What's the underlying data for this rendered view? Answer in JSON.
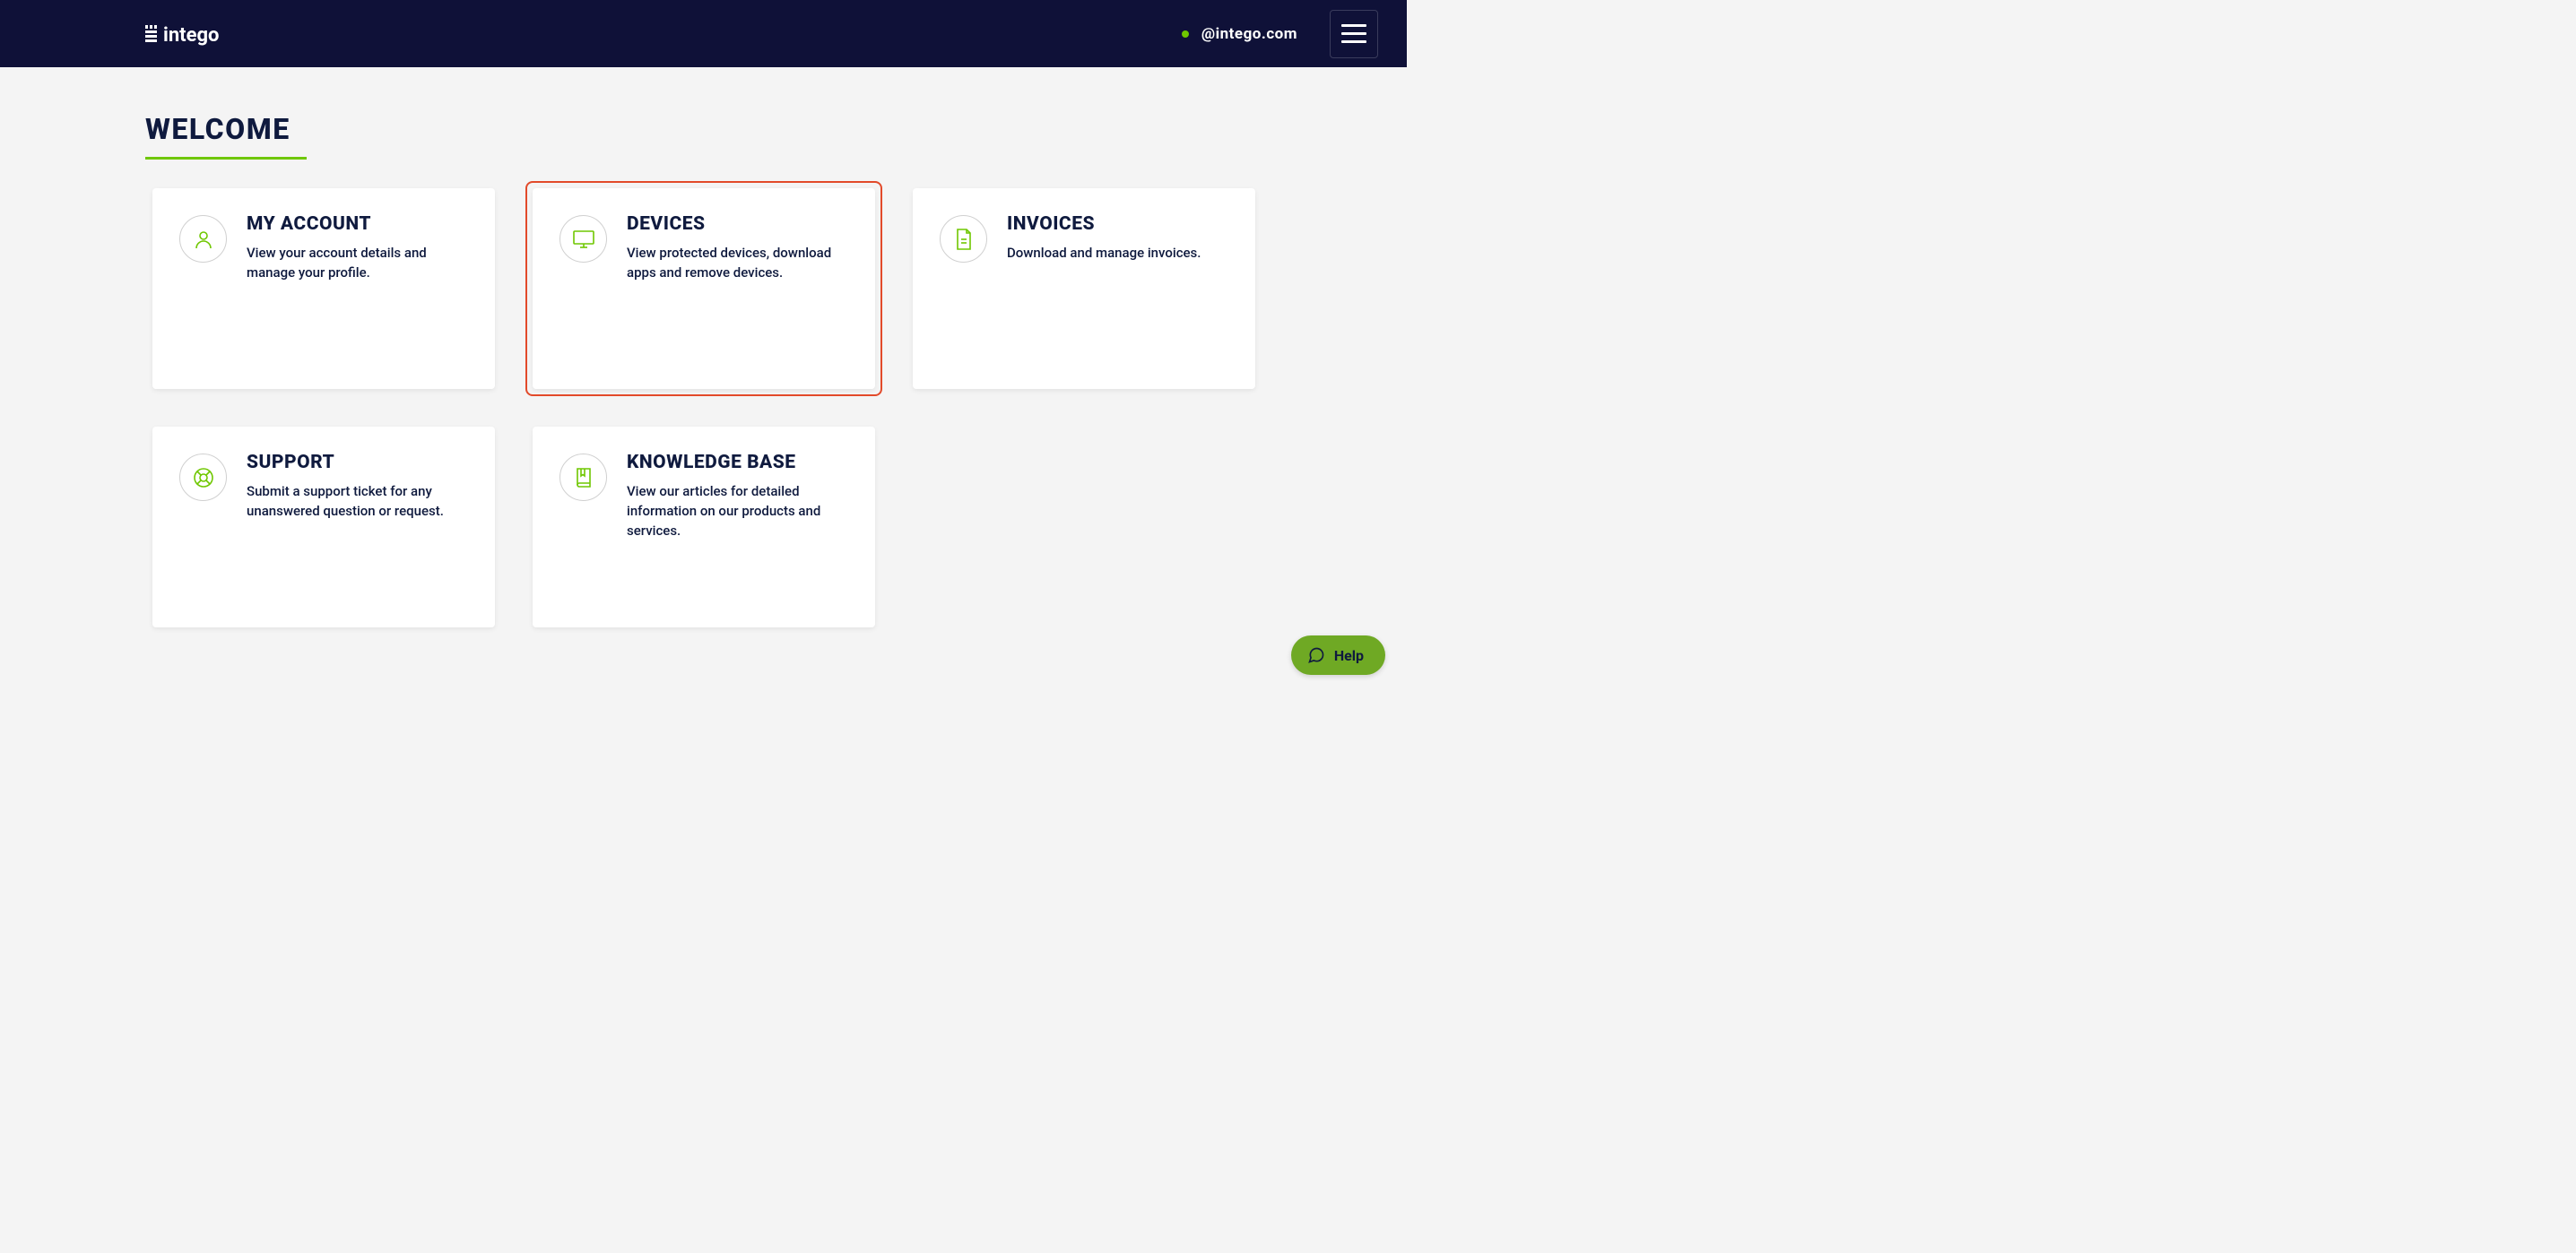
{
  "header": {
    "brand_name": "intego",
    "user_email": "@intego.com"
  },
  "welcome": {
    "title": "WELCOME"
  },
  "cards": [
    {
      "id": "my-account",
      "title": "MY ACCOUNT",
      "desc": "View your account details and manage your profile.",
      "highlight": false
    },
    {
      "id": "devices",
      "title": "DEVICES",
      "desc": "View protected devices, download apps and remove devices.",
      "highlight": true
    },
    {
      "id": "invoices",
      "title": "INVOICES",
      "desc": "Download and manage invoices.",
      "highlight": false
    },
    {
      "id": "support",
      "title": "SUPPORT",
      "desc": "Submit a support ticket for any unanswered question or request.",
      "highlight": false
    },
    {
      "id": "knowledge",
      "title": "KNOWLEDGE BASE",
      "desc": "View our articles for detailed information on our products and services.",
      "highlight": false
    }
  ],
  "help": {
    "label": "Help"
  }
}
